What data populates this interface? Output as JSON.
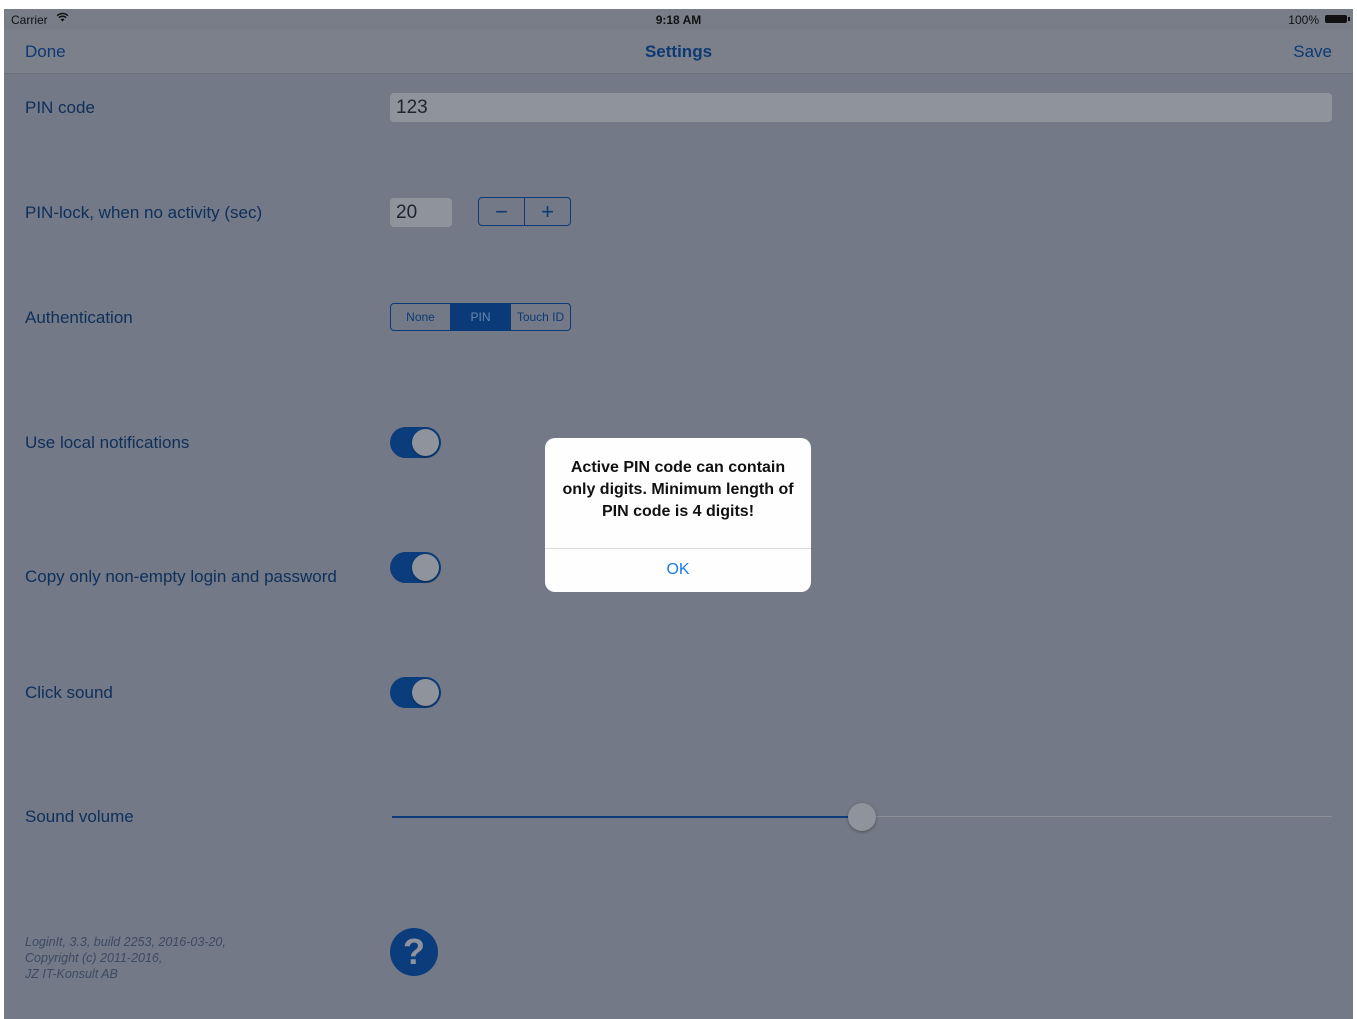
{
  "status_bar": {
    "carrier": "Carrier",
    "time": "9:18 AM",
    "battery": "100%",
    "wifi_icon": "wifi-icon"
  },
  "nav": {
    "left_label": "Done",
    "title": "Settings",
    "right_label": "Save"
  },
  "pin": {
    "label": "PIN code",
    "value": "123"
  },
  "pin_lock": {
    "label": "PIN-lock, when no activity (sec)",
    "value": "20",
    "minus": "−",
    "plus": "+"
  },
  "authentication": {
    "label": "Authentication",
    "options": [
      "None",
      "PIN",
      "Touch ID"
    ],
    "selected": "PIN"
  },
  "notifications": {
    "label": "Use local notifications",
    "on": true
  },
  "copy_nonempty": {
    "label": "Copy only non-empty login and password",
    "on": true
  },
  "click_sound": {
    "label": "Click sound",
    "on": true
  },
  "sound_volume": {
    "label": "Sound volume",
    "value": 0.5
  },
  "footer": {
    "line1": "LoginIt, 3.3, build 2253, 2016-03-20,",
    "line2": "Copyright (c) 2011-2016,",
    "line3": "JZ IT-Konsult AB"
  },
  "help": {
    "glyph": "?",
    "icon": "question-mark-icon"
  },
  "alert": {
    "message": "Active PIN code can contain only digits. Minimum length of PIN code is 4 digits!",
    "ok_label": "OK"
  },
  "colors": {
    "accent": "#0b3c7c",
    "alert_button": "#1a7ae3",
    "dimmed_background": "#737986"
  }
}
